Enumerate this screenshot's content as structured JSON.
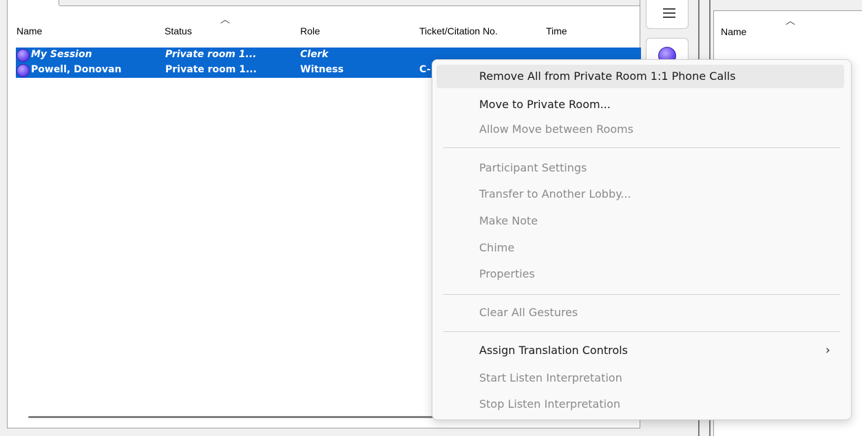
{
  "list": {
    "columns": [
      "Name",
      "Status",
      "Role",
      "Ticket/Citation No.",
      "Time"
    ],
    "rows": [
      {
        "name": "My Session",
        "status": "Private room 1...",
        "role": "Clerk",
        "ticket": "",
        "time": ""
      },
      {
        "name": "Powell, Donovan",
        "status": "Private room 1...",
        "role": "Witness",
        "ticket": "C-",
        "time": ""
      }
    ]
  },
  "right_panel": {
    "column": "Name"
  },
  "menu": {
    "items": [
      {
        "label": "Remove All from Private Room 1:1 Phone Calls",
        "enabled": true
      },
      {
        "label": "Move to Private Room...",
        "enabled": true
      },
      {
        "label": "Allow Move between Rooms",
        "enabled": false
      },
      {
        "label": "Participant Settings",
        "enabled": false
      },
      {
        "label": "Transfer to Another Lobby...",
        "enabled": false
      },
      {
        "label": "Make Note",
        "enabled": false
      },
      {
        "label": "Chime",
        "enabled": false
      },
      {
        "label": "Properties",
        "enabled": false
      },
      {
        "label": "Clear All Gestures",
        "enabled": false
      },
      {
        "label": "Assign Translation Controls",
        "enabled": true
      },
      {
        "label": "Start Listen Interpretation",
        "enabled": false
      },
      {
        "label": "Stop Listen Interpretation",
        "enabled": false
      }
    ]
  },
  "colors": {
    "selection": "#0a68d1",
    "status_dot": "#6b4bf0"
  },
  "icons": {
    "sort": "sort-up-icon",
    "menu": "hamburger-icon",
    "submenu": "chevron-right-icon"
  }
}
